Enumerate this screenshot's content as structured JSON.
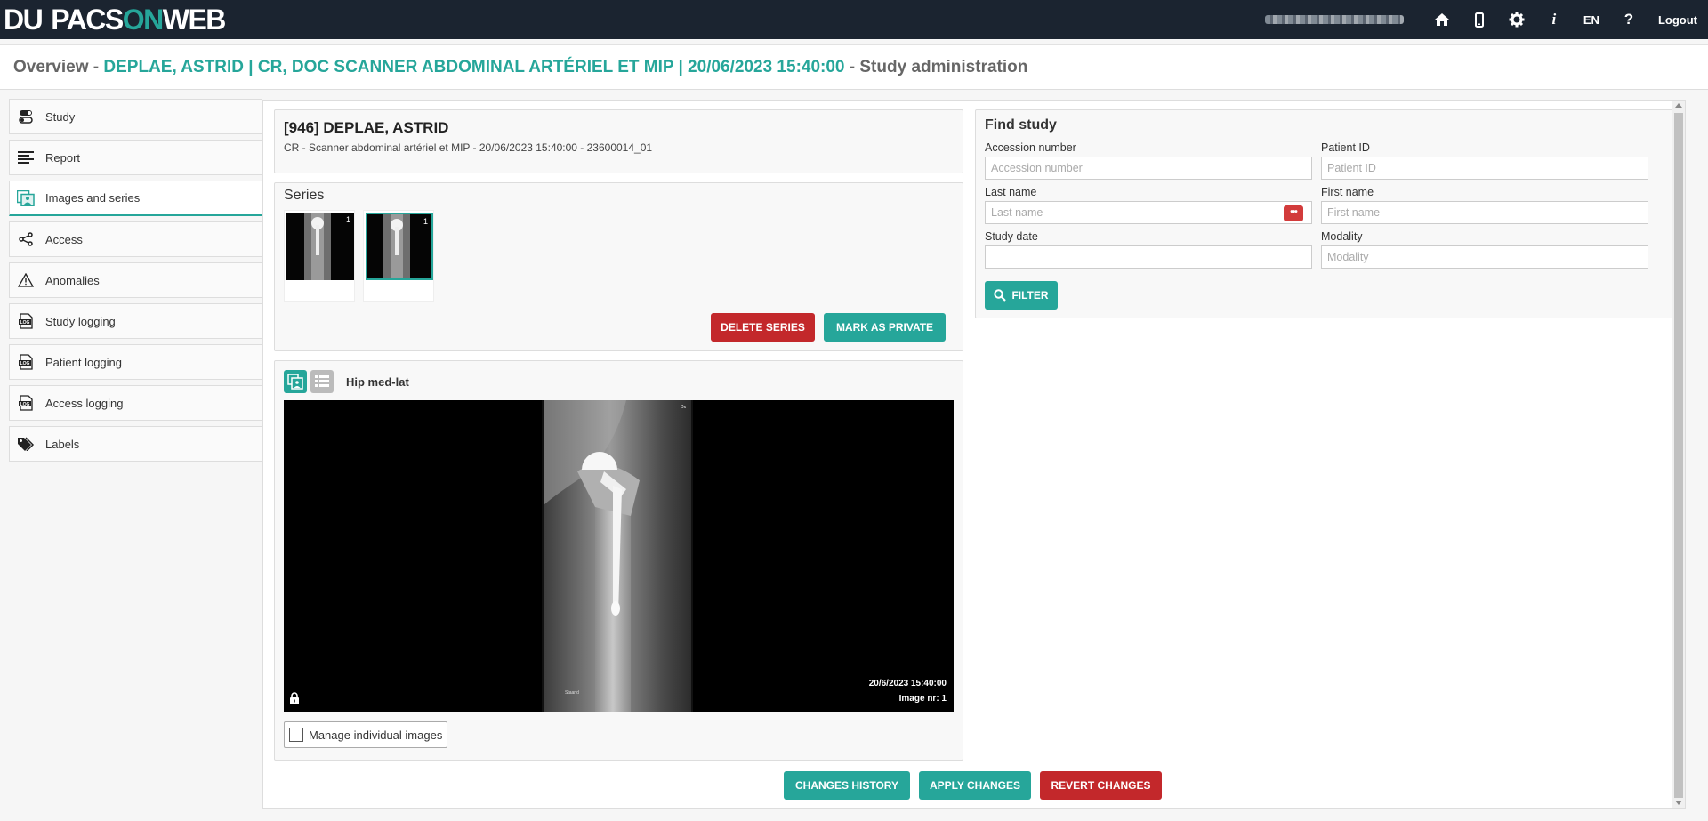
{
  "app": {
    "logo_du": "DU",
    "logo_pacs": "PACS",
    "logo_on": "ON",
    "logo_web": "WEB"
  },
  "topbar": {
    "language": "EN",
    "logout": "Logout",
    "icons": [
      "home-icon",
      "mobile-icon",
      "gear-icon",
      "info-icon",
      "help-icon"
    ]
  },
  "header": {
    "prefix": "Overview - ",
    "study": "DEPLAE, ASTRID | CR, DOC SCANNER ABDOMINAL ARTÉRIEL ET MIP | 20/06/2023 15:40:00",
    "suffix": " - Study administration"
  },
  "sidebar": {
    "items": [
      {
        "label": "Study",
        "icon": "study-icon"
      },
      {
        "label": "Report",
        "icon": "report-icon"
      },
      {
        "label": "Images and series",
        "icon": "images-icon"
      },
      {
        "label": "Access",
        "icon": "share-icon"
      },
      {
        "label": "Anomalies",
        "icon": "warning-icon"
      },
      {
        "label": "Study logging",
        "icon": "log-icon"
      },
      {
        "label": "Patient logging",
        "icon": "log-icon"
      },
      {
        "label": "Access logging",
        "icon": "log-icon"
      },
      {
        "label": "Labels",
        "icon": "tags-icon"
      }
    ],
    "active": "Images and series"
  },
  "study_info": {
    "title": "[946] DEPLAE, ASTRID",
    "subtitle": "CR - Scanner abdominal artériel et MIP - 20/06/2023 15:40:00 - 23600014_01"
  },
  "series": {
    "title": "Series",
    "thumbnails": [
      {
        "count": "1",
        "selected": false
      },
      {
        "count": "1",
        "selected": true
      }
    ],
    "delete_button": "DELETE SERIES",
    "private_button": "MARK AS PRIVATE"
  },
  "viewer": {
    "title": "Hip med-lat",
    "date": "20/6/2023 15:40:00",
    "image_nr": "Image nr: 1",
    "marker_top": "Dx",
    "marker_bottom": "Staand",
    "manage_label": "Manage individual images"
  },
  "find_study": {
    "title": "Find study",
    "accession_label": "Accession number",
    "accession_placeholder": "Accession number",
    "patient_id_label": "Patient ID",
    "patient_id_placeholder": "Patient ID",
    "last_name_label": "Last name",
    "last_name_placeholder": "Last name",
    "first_name_label": "First name",
    "first_name_placeholder": "First name",
    "study_date_label": "Study date",
    "study_date_value": "",
    "modality_label": "Modality",
    "modality_placeholder": "Modality",
    "filter_button": "FILTER"
  },
  "footer_buttons": {
    "history": "CHANGES HISTORY",
    "apply": "APPLY CHANGES",
    "revert": "REVERT CHANGES"
  },
  "colors": {
    "accent": "#26a69a",
    "danger": "#c3282b",
    "topbar": "#1b2430"
  }
}
